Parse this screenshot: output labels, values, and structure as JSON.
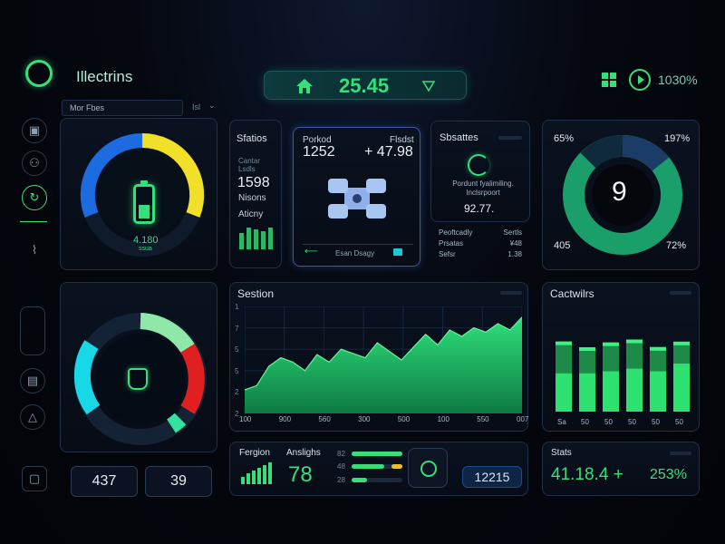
{
  "app": {
    "title": "Illectrins"
  },
  "header": {
    "value": "25.45",
    "percent": "1030%"
  },
  "dropdown": {
    "label": "Mor Fbes",
    "value": "Isl"
  },
  "panel_gauge": {
    "value": "4.180",
    "sub": "ssua"
  },
  "panel_service": {
    "title": "Sfatios",
    "sub_label": "Cantar Lsdls",
    "value": "1598",
    "line2": "Nisons",
    "line3": "Aticny"
  },
  "panel_center": {
    "label_left": "Porkod",
    "label_right": "Flsdst",
    "value_left": "1252",
    "value_right": "+ 47.98",
    "footer": "Esan Dsagy"
  },
  "panel_status": {
    "title": "Sbsattes",
    "caption": "Pordunt fyalimiling. Inclsrpoort",
    "value": "92.77.",
    "rows": [
      {
        "left": "Peoftcadly",
        "right": "Sertls"
      },
      {
        "left": "Prsatas",
        "right": "¥48"
      },
      {
        "left": "Sefsr",
        "right": "1.38"
      }
    ]
  },
  "panel_donut": {
    "center": "9",
    "tl": "65%",
    "tr": "197%",
    "bl": "405",
    "br": "72%"
  },
  "panel_area": {
    "title": "Sestion",
    "yticks": [
      "1",
      "7",
      "5",
      "5",
      "2",
      "2"
    ],
    "xticks": [
      "100",
      "900",
      "560",
      "300",
      "500",
      "100",
      "550",
      "007"
    ]
  },
  "panel_bars": {
    "title": "Cactwilrs",
    "xticks": [
      "Sa",
      "50",
      "50",
      "50",
      "50",
      "50"
    ]
  },
  "bottom_left": {
    "v1": "437",
    "v2": "39"
  },
  "panel_region": {
    "title": "Fergion",
    "sub": "Anslighs",
    "value": "78",
    "rows": [
      "82",
      "48",
      "28"
    ],
    "badge": "12215"
  },
  "panel_stats": {
    "title": "Stats",
    "value": "41.18.4 +",
    "pct": "253%"
  },
  "colors": {
    "accent_green": "#35e07a",
    "accent_blue": "#1d6be0",
    "accent_yellow": "#f0e02a",
    "accent_red": "#e02020",
    "accent_cyan": "#18d8e8"
  },
  "chart_data": [
    {
      "type": "area",
      "title": "Sestion",
      "x": [
        "100",
        "900",
        "560",
        "300",
        "500",
        "100",
        "550",
        "007"
      ],
      "values": [
        22,
        26,
        44,
        52,
        48,
        40,
        55,
        48,
        60,
        56,
        52,
        66,
        58,
        50,
        62,
        74,
        64,
        78,
        72,
        80,
        76,
        84,
        78,
        90
      ],
      "ylim": [
        0,
        100
      ],
      "grid": true
    },
    {
      "type": "bar",
      "title": "Cactwilrs",
      "categories": [
        "Sa",
        "50",
        "50",
        "50",
        "50",
        "50"
      ],
      "series": [
        {
          "values": [
            0.55,
            0.45,
            0.5,
            0.5,
            0.42,
            0.38
          ]
        },
        {
          "values": [
            0.4,
            0.4,
            0.42,
            0.45,
            0.42,
            0.5
          ]
        }
      ]
    }
  ]
}
